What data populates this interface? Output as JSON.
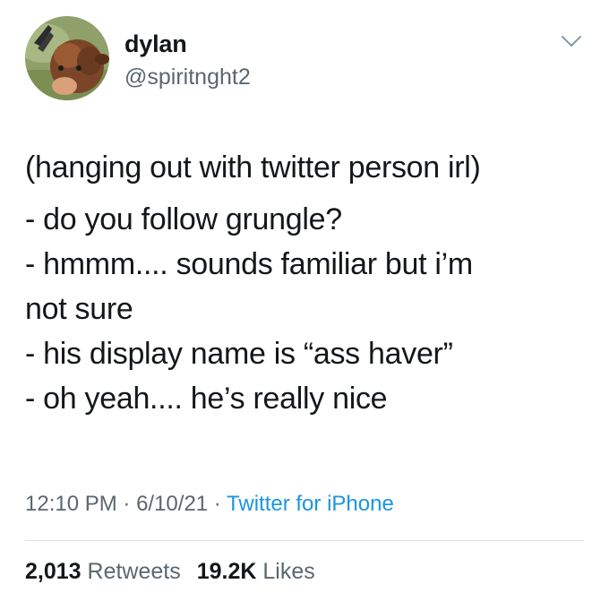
{
  "user": {
    "display_name": "dylan",
    "handle": "@spiritnght2",
    "avatar_icon": "cow-avatar-icon"
  },
  "tweet": {
    "lines": [
      "(hanging out with twitter person irl)",
      "- do you follow grungle?",
      "- hmmm.... sounds familiar but i’m",
      "not sure",
      "- his display name is “ass haver”",
      "- oh yeah.... he’s really nice"
    ]
  },
  "meta": {
    "time": "12:10 PM",
    "separator": " · ",
    "date": "6/10/21",
    "source": "Twitter for iPhone"
  },
  "stats": {
    "retweets_count": "2,013",
    "retweets_label": "Retweets",
    "likes_count": "19.2K",
    "likes_label": "Likes"
  },
  "colors": {
    "text": "#14171a",
    "secondary": "#5b6670",
    "link": "#1b95e0"
  }
}
